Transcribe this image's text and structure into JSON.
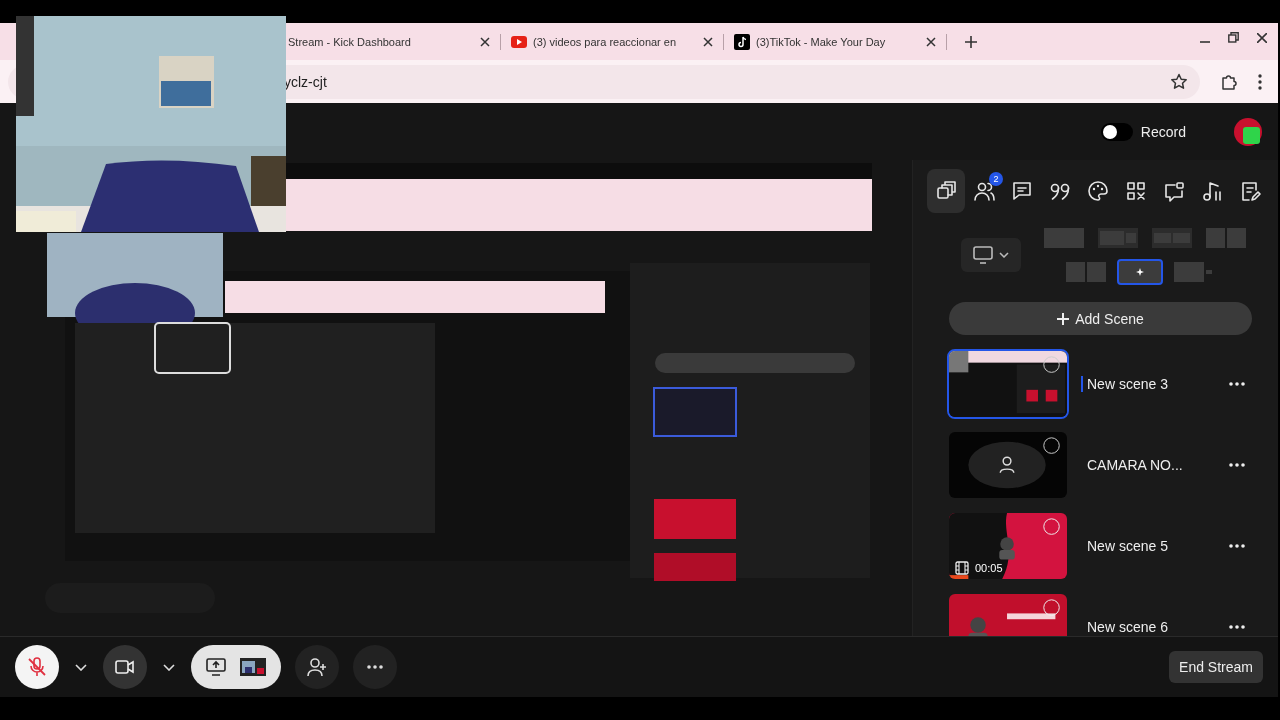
{
  "browser": {
    "tabs": [
      {
        "title": "Stream - Kick Dashboard",
        "kind": "plain",
        "selected": false
      },
      {
        "title": "(3) videos para reaccionar en",
        "kind": "youtube",
        "selected": false
      },
      {
        "title": "(3)TikTok - Make Your Day",
        "kind": "tiktok",
        "selected": false
      }
    ],
    "address": {
      "value": "yclz-cjt"
    }
  },
  "header": {
    "record": {
      "label": "Record",
      "on": false
    }
  },
  "sidebar": {
    "tools": [
      {
        "kind": "scenes",
        "selected": true
      },
      {
        "kind": "people",
        "selected": false,
        "badge": "2"
      },
      {
        "kind": "chat",
        "selected": false
      },
      {
        "kind": "quote",
        "selected": false
      },
      {
        "kind": "palette",
        "selected": false
      },
      {
        "kind": "qr",
        "selected": false
      },
      {
        "kind": "banner",
        "selected": false
      },
      {
        "kind": "music",
        "selected": false
      },
      {
        "kind": "notes",
        "selected": false
      }
    ],
    "layouts": [
      {
        "kind": "full",
        "selected": false
      },
      {
        "kind": "pip",
        "selected": false
      },
      {
        "kind": "split",
        "selected": false
      },
      {
        "kind": "halves",
        "selected": false
      },
      {
        "kind": "halves",
        "selected": false
      },
      {
        "kind": "custom",
        "selected": true
      },
      {
        "kind": "side",
        "selected": false
      }
    ],
    "add_scene": "Add Scene",
    "scenes": [
      {
        "name": "New scene 3",
        "kind": "screen",
        "selected": true
      },
      {
        "name": "CAMARA NO...",
        "kind": "camera",
        "selected": false
      },
      {
        "name": "New scene 5",
        "kind": "red",
        "duration": "00:05",
        "selected": false
      },
      {
        "name": "New scene 6",
        "kind": "ending",
        "selected": false
      }
    ]
  },
  "controls": {
    "mic_muted": true,
    "end_stream": "End Stream"
  }
}
